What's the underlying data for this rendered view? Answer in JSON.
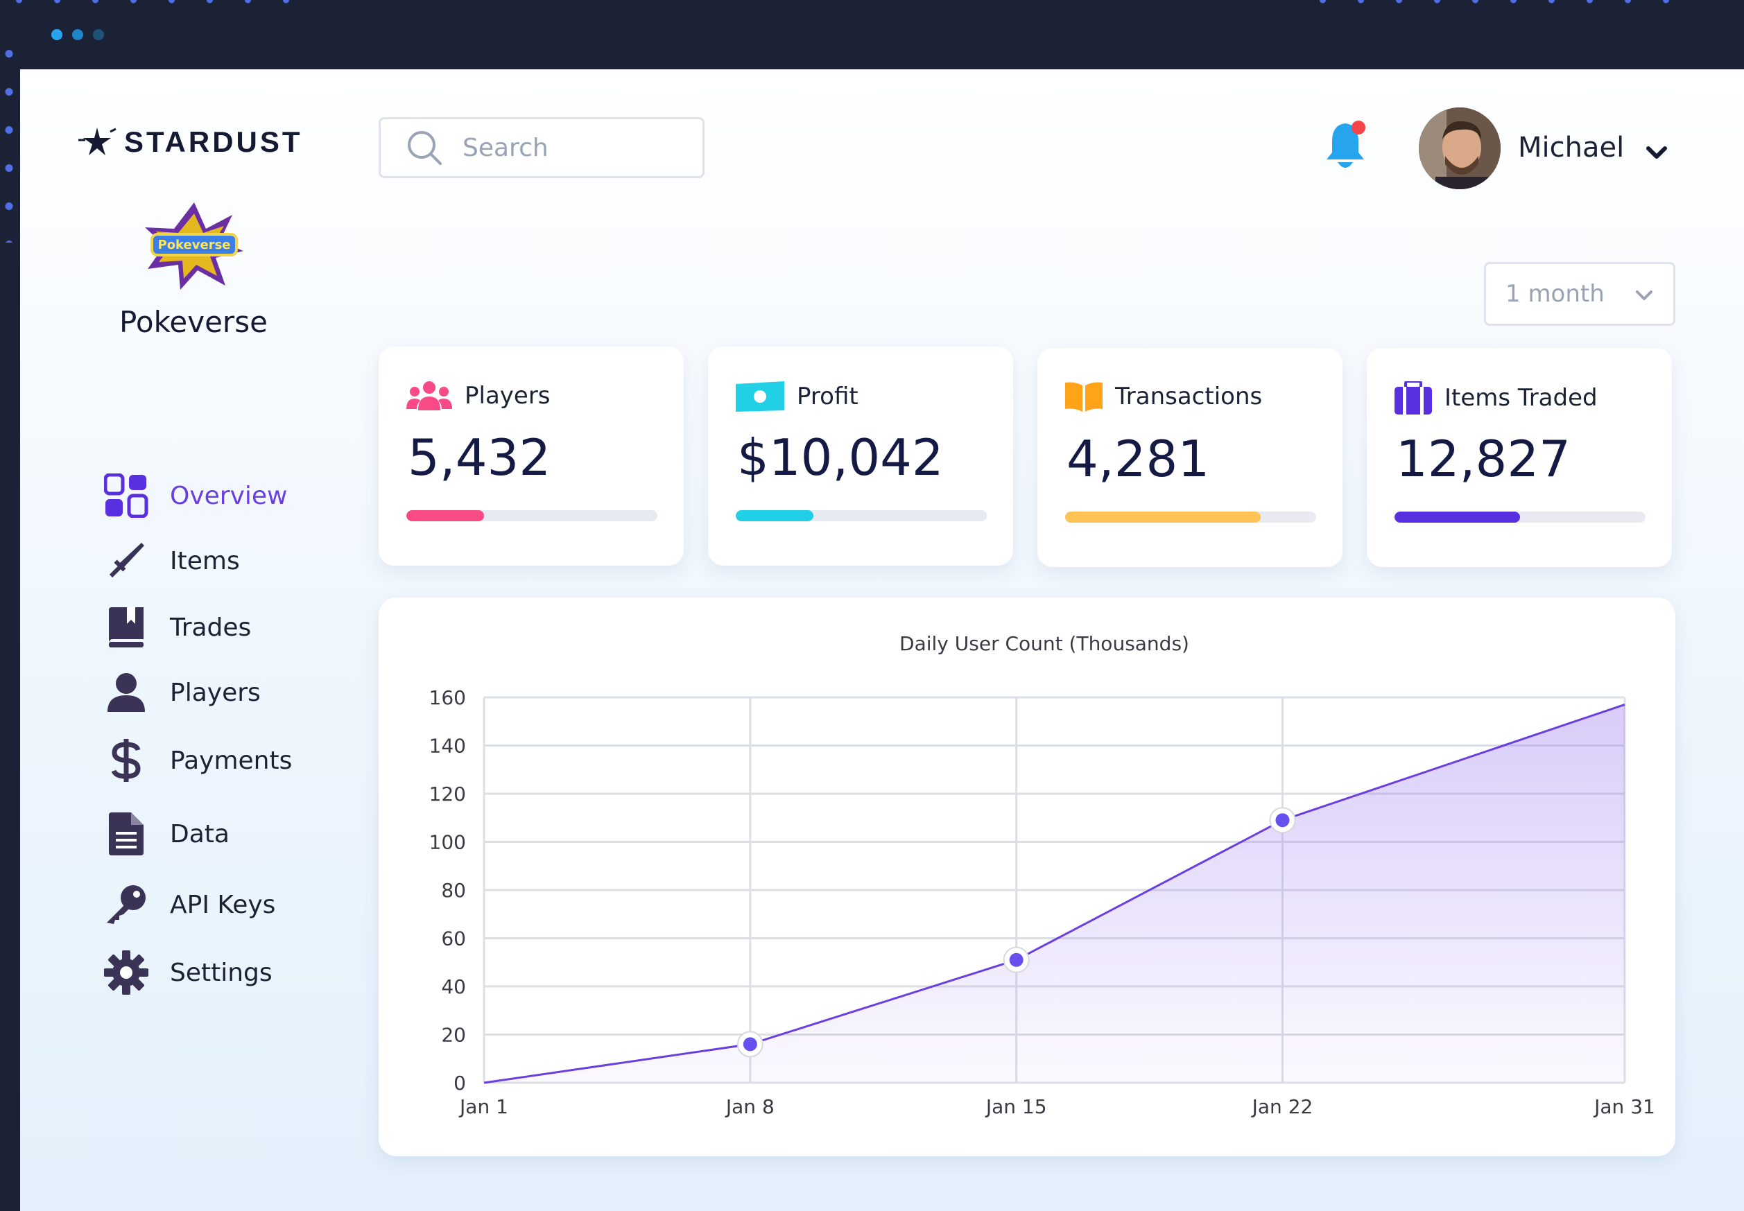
{
  "brand": {
    "name": "STARDUST"
  },
  "game": {
    "name": "Pokeverse",
    "logo_text": "Pokeverse"
  },
  "search": {
    "placeholder": "Search"
  },
  "user": {
    "name": "Michael"
  },
  "range": {
    "selected": "1 month"
  },
  "nav": {
    "items": [
      {
        "label": "Overview",
        "icon": "grid-icon",
        "active": true
      },
      {
        "label": "Items",
        "icon": "sword-icon"
      },
      {
        "label": "Trades",
        "icon": "book-icon"
      },
      {
        "label": "Players",
        "icon": "user-icon"
      },
      {
        "label": "Payments",
        "icon": "dollar-icon"
      },
      {
        "label": "Data",
        "icon": "document-icon"
      },
      {
        "label": "API Keys",
        "icon": "key-icon"
      },
      {
        "label": "Settings",
        "icon": "gear-icon"
      }
    ]
  },
  "stats": [
    {
      "title": "Players",
      "value": "5,432",
      "progress": 0.31,
      "color": "#f74a86",
      "icon": "users-icon"
    },
    {
      "title": "Profit",
      "value": "$10,042",
      "progress": 0.31,
      "color": "#21d0e6",
      "icon": "money-icon"
    },
    {
      "title": "Transactions",
      "value": "4,281",
      "progress": 0.78,
      "color": "#ffc254",
      "icon": "open-book-icon"
    },
    {
      "title": "Items Traded",
      "value": "12,827",
      "progress": 0.5,
      "color": "#5a2fe0",
      "icon": "briefcase-icon"
    }
  ],
  "colors": {
    "accent": "#6a3fe0",
    "line": "#6a3fe0",
    "point": "#6650f0"
  },
  "chart_data": {
    "type": "area",
    "title": "Daily User Count (Thousands)",
    "xlabel": "",
    "ylabel": "",
    "x": [
      "Jan 1",
      "Jan 8",
      "Jan 15",
      "Jan 22",
      "Jan 31"
    ],
    "x_days": [
      1,
      8,
      15,
      22,
      31
    ],
    "series": [
      {
        "values": [
          0,
          16,
          51,
          109,
          157
        ]
      }
    ],
    "markers_on": [
      "Jan 8",
      "Jan 15",
      "Jan 22"
    ],
    "ylim": [
      0,
      160
    ],
    "yticks": [
      0,
      20,
      40,
      60,
      80,
      100,
      120,
      140,
      160
    ],
    "grid": true
  }
}
